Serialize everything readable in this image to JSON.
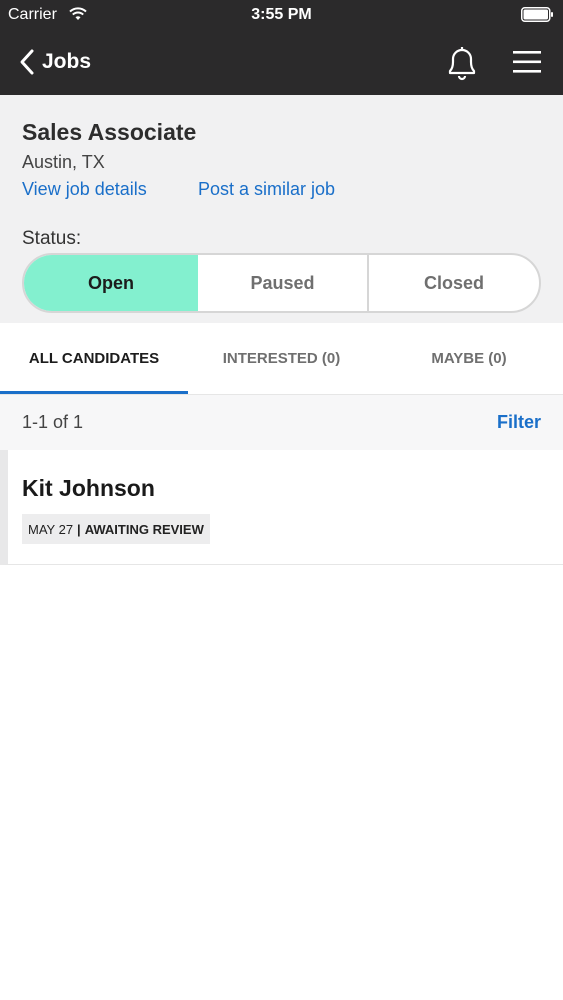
{
  "status_bar": {
    "carrier": "Carrier",
    "time": "3:55 PM"
  },
  "nav": {
    "back_label": "Jobs",
    "icons": [
      "chevron-left-icon",
      "bell-icon",
      "hamburger-menu-icon"
    ]
  },
  "job": {
    "title": "Sales Associate",
    "location": "Austin, TX",
    "view_details_label": "View job details",
    "post_similar_label": "Post a similar job",
    "status_label": "Status:",
    "status_options": [
      "Open",
      "Paused",
      "Closed"
    ],
    "selected_status": "Open"
  },
  "tabs": {
    "all": "ALL CANDIDATES",
    "interested": "INTERESTED (0)",
    "maybe": "MAYBE (0)",
    "active": "ALL CANDIDATES"
  },
  "results": {
    "count": "1-1 of 1",
    "filter_label": "Filter"
  },
  "candidates": [
    {
      "name": "Kit Johnson",
      "date": "MAY 27",
      "separator": "|",
      "status": "AWAITING REVIEW"
    }
  ],
  "colors": {
    "nav_background": "#2b2a2b",
    "accent": "#1a6fc9",
    "open_selected": "#83f0cf"
  }
}
